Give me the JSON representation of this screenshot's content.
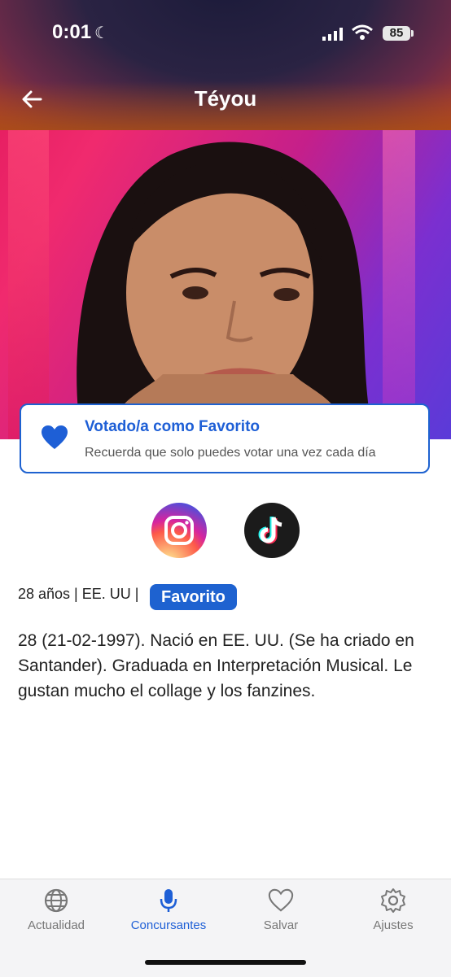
{
  "status_bar": {
    "time": "0:01",
    "battery": "85"
  },
  "header": {
    "title": "Téyou"
  },
  "vote_card": {
    "title": "Votado/a como Favorito",
    "subtitle": "Recuerda que solo puedes votar una vez cada día"
  },
  "social": [
    {
      "name": "instagram-icon"
    },
    {
      "name": "tiktok-icon"
    }
  ],
  "profile": {
    "meta": "28 años | EE. UU |",
    "badge": "Favorito",
    "bio": "28 (21-02-1997). Nació en EE. UU. (Se ha criado en Santander). Graduada en Interpretación Musical. Le gustan mucho el collage y los fanzines."
  },
  "tabs": [
    {
      "label": "Actualidad",
      "icon": "globe-icon",
      "active": false
    },
    {
      "label": "Concursantes",
      "icon": "microphone-icon",
      "active": true
    },
    {
      "label": "Salvar",
      "icon": "heart-icon",
      "active": false
    },
    {
      "label": "Ajustes",
      "icon": "gear-icon",
      "active": false
    }
  ],
  "colors": {
    "accent": "#1e62d0",
    "hero_pink": "#e0185a",
    "hero_purple": "#7b2fd0"
  }
}
